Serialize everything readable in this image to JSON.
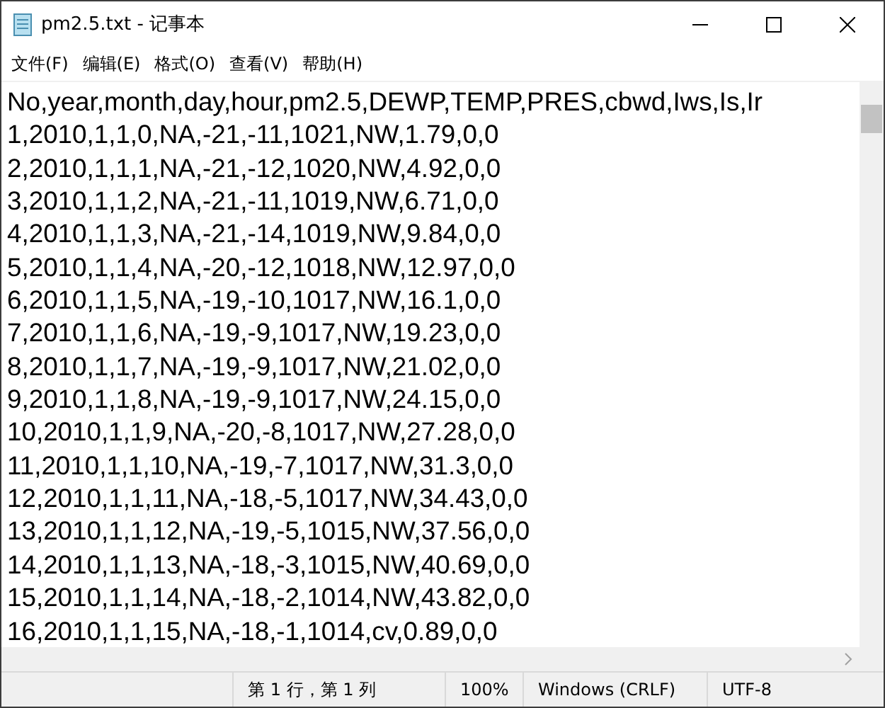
{
  "window": {
    "title": "pm2.5.txt - 记事本"
  },
  "menu": [
    "文件(F)",
    "编辑(E)",
    "格式(O)",
    "查看(V)",
    "帮助(H)"
  ],
  "lines": [
    "No,year,month,day,hour,pm2.5,DEWP,TEMP,PRES,cbwd,Iws,Is,Ir",
    "1,2010,1,1,0,NA,-21,-11,1021,NW,1.79,0,0",
    "2,2010,1,1,1,NA,-21,-12,1020,NW,4.92,0,0",
    "3,2010,1,1,2,NA,-21,-11,1019,NW,6.71,0,0",
    "4,2010,1,1,3,NA,-21,-14,1019,NW,9.84,0,0",
    "5,2010,1,1,4,NA,-20,-12,1018,NW,12.97,0,0",
    "6,2010,1,1,5,NA,-19,-10,1017,NW,16.1,0,0",
    "7,2010,1,1,6,NA,-19,-9,1017,NW,19.23,0,0",
    "8,2010,1,1,7,NA,-19,-9,1017,NW,21.02,0,0",
    "9,2010,1,1,8,NA,-19,-9,1017,NW,24.15,0,0",
    "10,2010,1,1,9,NA,-20,-8,1017,NW,27.28,0,0",
    "11,2010,1,1,10,NA,-19,-7,1017,NW,31.3,0,0",
    "12,2010,1,1,11,NA,-18,-5,1017,NW,34.43,0,0",
    "13,2010,1,1,12,NA,-19,-5,1015,NW,37.56,0,0",
    "14,2010,1,1,13,NA,-18,-3,1015,NW,40.69,0,0",
    "15,2010,1,1,14,NA,-18,-2,1014,NW,43.82,0,0",
    "16,2010,1,1,15,NA,-18,-1,1014,cv,0.89,0,0"
  ],
  "status_bar": {
    "position": "第 1 行，第 1 列",
    "zoom": "100%",
    "line_ending": "Windows (CRLF)",
    "encoding": "UTF-8"
  }
}
